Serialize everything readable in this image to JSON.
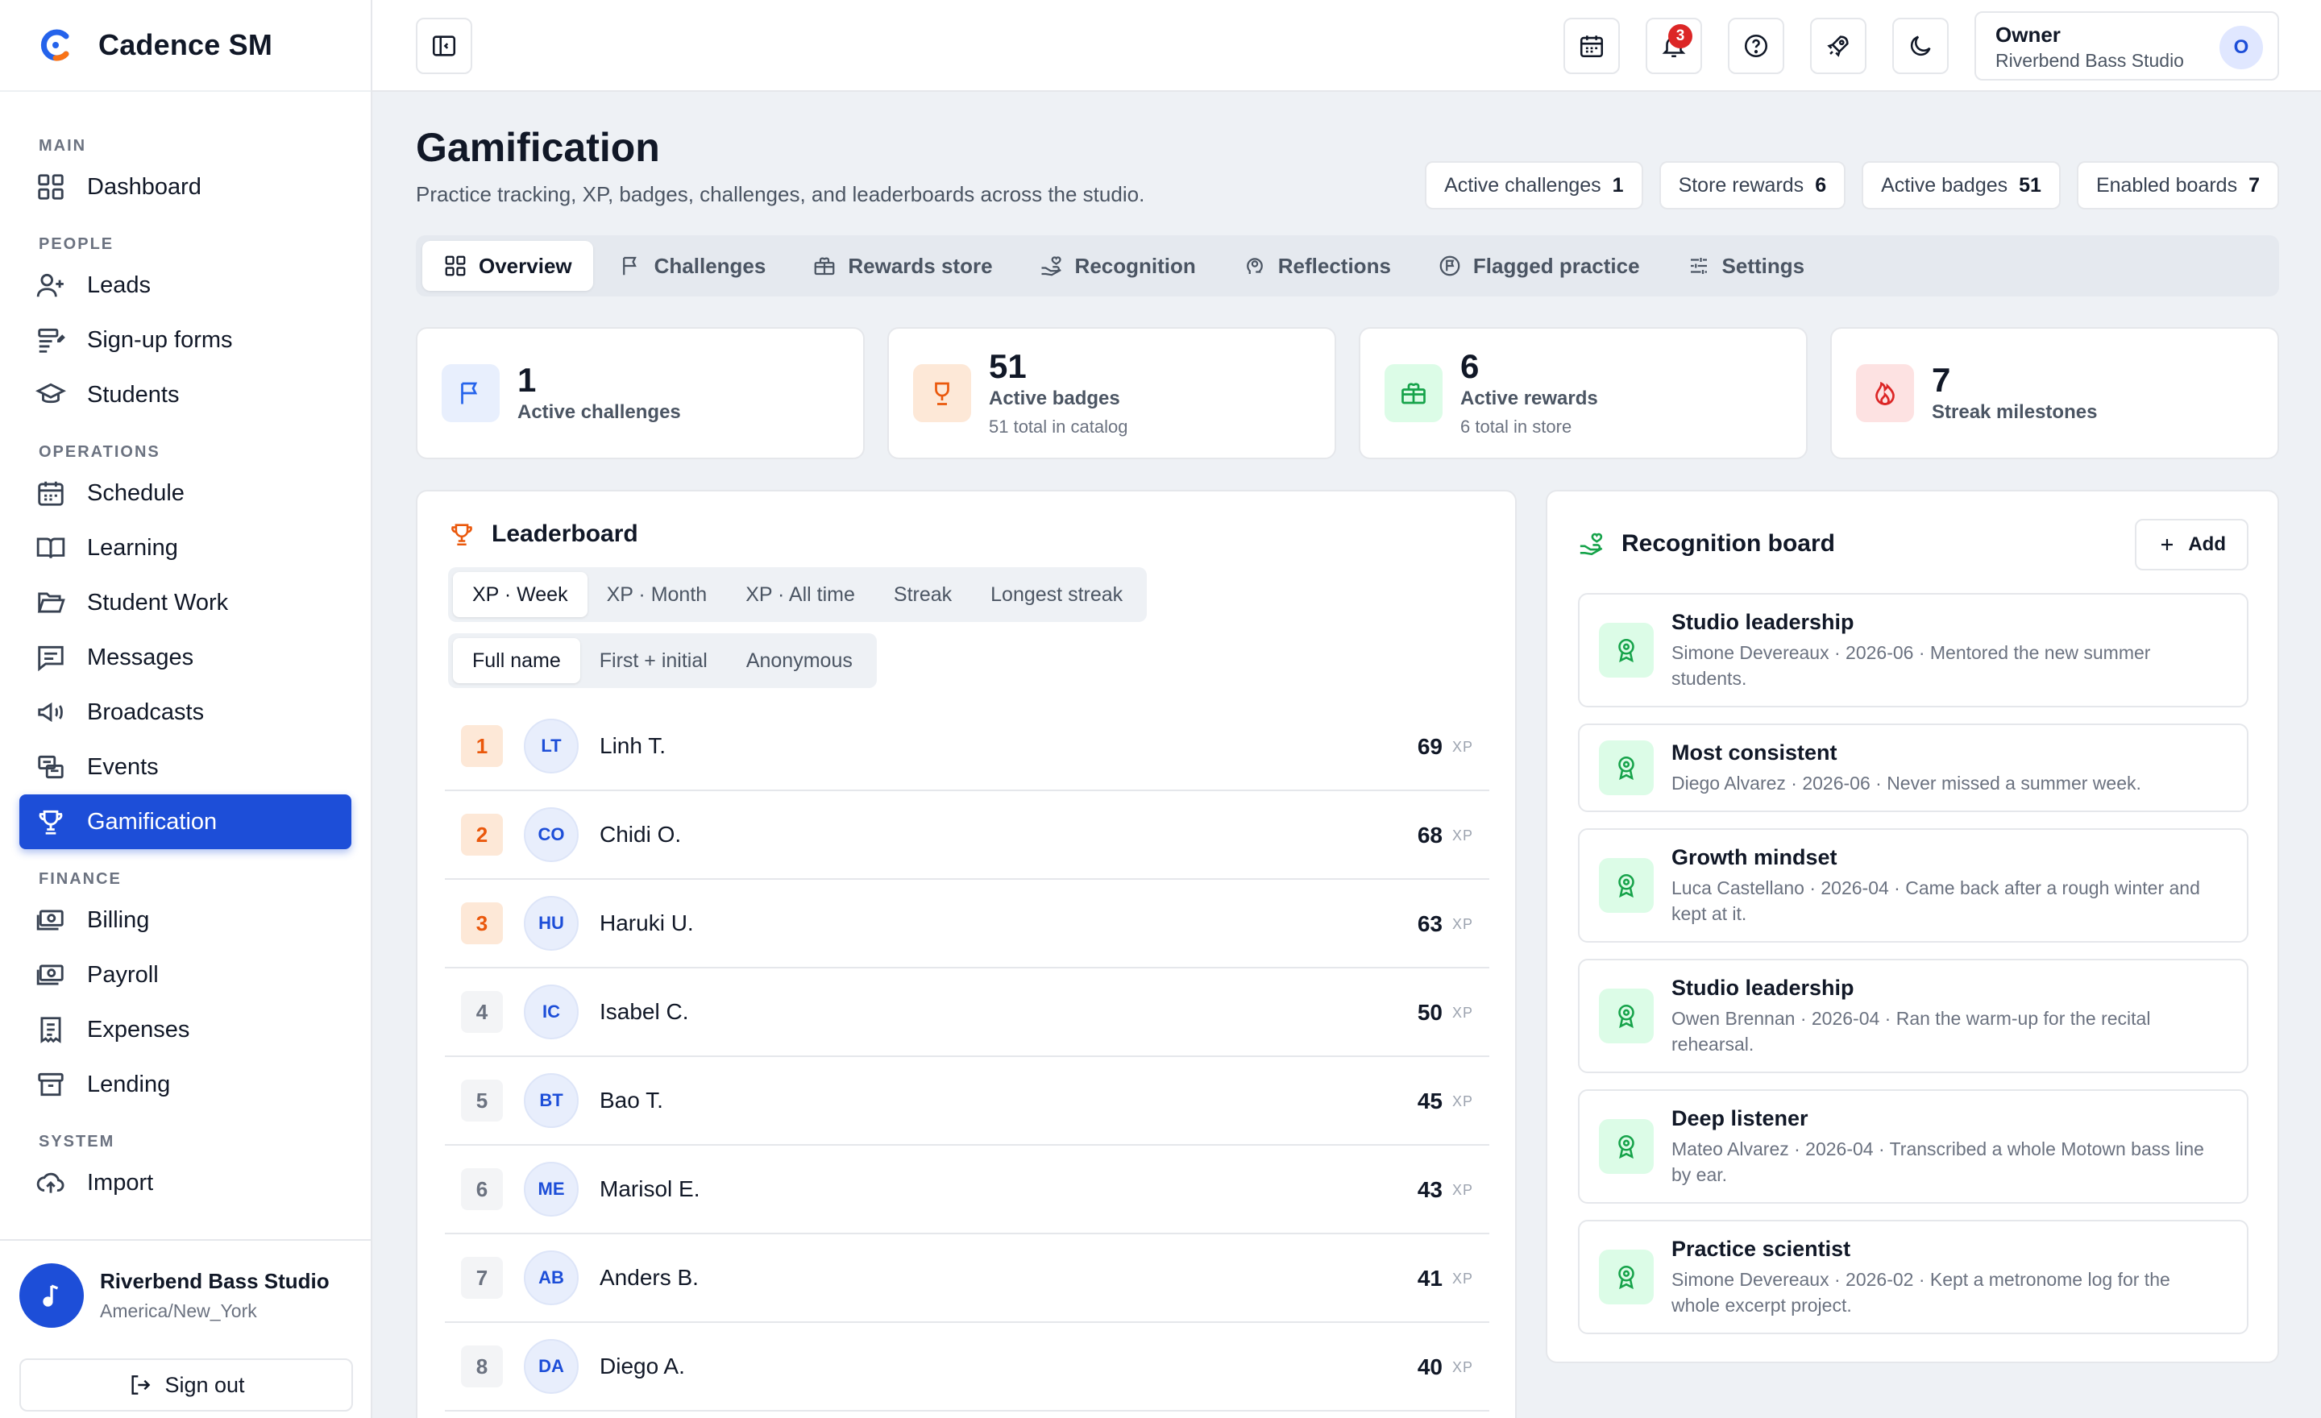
{
  "app": {
    "name": "Cadence SM"
  },
  "sidebar": {
    "sections": {
      "main": "MAIN",
      "people": "PEOPLE",
      "operations": "OPERATIONS",
      "finance": "FINANCE",
      "system": "SYSTEM"
    },
    "items": {
      "dashboard": "Dashboard",
      "leads": "Leads",
      "signup_forms": "Sign-up forms",
      "students": "Students",
      "schedule": "Schedule",
      "learning": "Learning",
      "student_work": "Student Work",
      "messages": "Messages",
      "broadcasts": "Broadcasts",
      "events": "Events",
      "gamification": "Gamification",
      "billing": "Billing",
      "payroll": "Payroll",
      "expenses": "Expenses",
      "lending": "Lending",
      "import": "Import"
    },
    "active": "gamification",
    "footer": {
      "studio_name": "Riverbend Bass Studio",
      "timezone": "America/New_York",
      "sign_out": "Sign out"
    }
  },
  "topbar": {
    "notifications_count": "3",
    "owner_role": "Owner",
    "owner_studio": "Riverbend Bass Studio",
    "owner_initial": "O"
  },
  "page": {
    "title": "Gamification",
    "subtitle": "Practice tracking, XP, badges, challenges, and leaderboards across the studio.",
    "stats": [
      {
        "label": "Active challenges",
        "value": "1"
      },
      {
        "label": "Store rewards",
        "value": "6"
      },
      {
        "label": "Active badges",
        "value": "51"
      },
      {
        "label": "Enabled boards",
        "value": "7"
      }
    ],
    "tabs": [
      {
        "label": "Overview",
        "icon": "grid-icon",
        "active": true
      },
      {
        "label": "Challenges",
        "icon": "flag-icon"
      },
      {
        "label": "Rewards store",
        "icon": "gift-icon"
      },
      {
        "label": "Recognition",
        "icon": "hand-heart-icon"
      },
      {
        "label": "Reflections",
        "icon": "thought-icon"
      },
      {
        "label": "Flagged practice",
        "icon": "flag-circle-icon"
      },
      {
        "label": "Settings",
        "icon": "sliders-icon"
      }
    ]
  },
  "kpis": [
    {
      "value": "1",
      "label": "Active challenges",
      "sub": "",
      "icon": "flag-icon",
      "color": "#2563eb",
      "bg": "#e8effd"
    },
    {
      "value": "51",
      "label": "Active badges",
      "sub": "51 total in catalog",
      "icon": "trophy-icon",
      "color": "#ea580c",
      "bg": "#fde8d7"
    },
    {
      "value": "6",
      "label": "Active rewards",
      "sub": "6 total in store",
      "icon": "gift-icon",
      "color": "#16a34a",
      "bg": "#dcfce7"
    },
    {
      "value": "7",
      "label": "Streak milestones",
      "sub": "",
      "icon": "flame-icon",
      "color": "#dc2626",
      "bg": "#fde2e2"
    }
  ],
  "leaderboard": {
    "title": "Leaderboard",
    "metric_tabs": [
      "XP · Week",
      "XP · Month",
      "XP · All time",
      "Streak",
      "Longest streak"
    ],
    "active_metric": 0,
    "name_tabs": [
      "Full name",
      "First + initial",
      "Anonymous"
    ],
    "active_name": 0,
    "unit": "XP",
    "rows": [
      {
        "rank": "1",
        "initials": "LT",
        "name": "Linh T.",
        "xp": "69"
      },
      {
        "rank": "2",
        "initials": "CO",
        "name": "Chidi O.",
        "xp": "68"
      },
      {
        "rank": "3",
        "initials": "HU",
        "name": "Haruki U.",
        "xp": "63"
      },
      {
        "rank": "4",
        "initials": "IC",
        "name": "Isabel C.",
        "xp": "50"
      },
      {
        "rank": "5",
        "initials": "BT",
        "name": "Bao T.",
        "xp": "45"
      },
      {
        "rank": "6",
        "initials": "ME",
        "name": "Marisol E.",
        "xp": "43"
      },
      {
        "rank": "7",
        "initials": "AB",
        "name": "Anders B.",
        "xp": "41"
      },
      {
        "rank": "8",
        "initials": "DA",
        "name": "Diego A.",
        "xp": "40"
      }
    ]
  },
  "recognition": {
    "title": "Recognition board",
    "add_label": "Add",
    "items": [
      {
        "title": "Studio leadership",
        "desc": "Simone Devereaux · 2026-06 · Mentored the new summer students."
      },
      {
        "title": "Most consistent",
        "desc": "Diego Alvarez · 2026-06 · Never missed a summer week."
      },
      {
        "title": "Growth mindset",
        "desc": "Luca Castellano · 2026-04 · Came back after a rough winter and kept at it."
      },
      {
        "title": "Studio leadership",
        "desc": "Owen Brennan · 2026-04 · Ran the warm-up for the recital rehearsal."
      },
      {
        "title": "Deep listener",
        "desc": "Mateo Alvarez · 2026-04 · Transcribed a whole Motown bass line by ear."
      },
      {
        "title": "Practice scientist",
        "desc": "Simone Devereaux · 2026-02 · Kept a metronome log for the whole excerpt project."
      }
    ]
  }
}
